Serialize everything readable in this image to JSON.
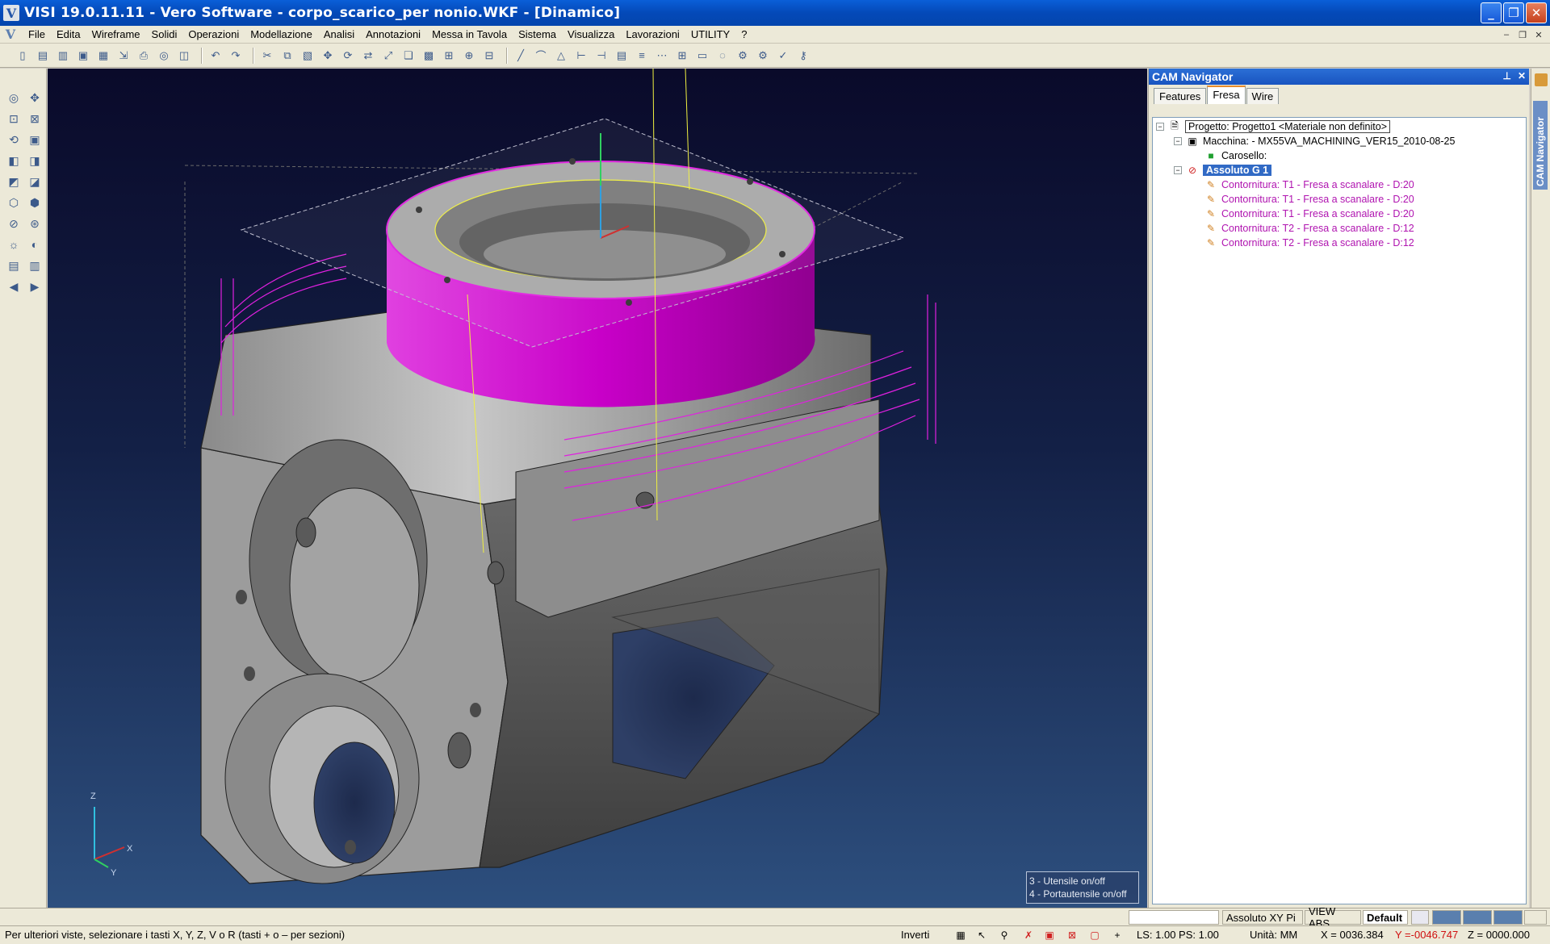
{
  "window": {
    "title": "VISI 19.0.11.11 - Vero Software - corpo_scarico_per nonio.WKF - [Dinamico]",
    "minimize": "_",
    "maximize": "❐",
    "close": "✕"
  },
  "menu": {
    "items": [
      "File",
      "Edita",
      "Wireframe",
      "Solidi",
      "Operazioni",
      "Modellazione",
      "Analisi",
      "Annotazioni",
      "Messa in Tavola",
      "Sistema",
      "Visualizza",
      "Lavorazioni",
      "UTILITY",
      "?"
    ]
  },
  "viewport": {
    "hint_lines": [
      "3 - Utensile on/off",
      "4 - Portautensile on/off"
    ],
    "triad_labels": {
      "x": "X",
      "y": "Y",
      "z": "Z"
    }
  },
  "cam_navigator": {
    "title": "CAM Navigator",
    "side_label": "CAM Navigator",
    "tabs": [
      {
        "label": "Features",
        "active": false
      },
      {
        "label": "Fresa",
        "active": true
      },
      {
        "label": "Wire",
        "active": false
      }
    ],
    "tree": {
      "project": "Progetto: Progetto1 <Materiale non definito>",
      "machine": "Macchina: - MX55VA_MACHINING_VER15_2010-08-25",
      "carousel": "Carosello:",
      "group": "Assoluto G 1",
      "operations": [
        "Contornitura: T1 - Fresa a scanalare - D:20",
        "Contornitura: T1 - Fresa a scanalare - D:20",
        "Contornitura: T1 - Fresa a scanalare - D:20",
        "Contornitura: T2 - Fresa a scanalare - D:12",
        "Contornitura: T2 - Fresa a scanalare - D:12"
      ]
    }
  },
  "status": {
    "search_placeholder": "",
    "plane": "Assoluto XY Pi",
    "view": "VIEW ABS",
    "layer": "Default",
    "message": "Per ulteriori viste, selezionare i tasti X, Y, Z, V o R (tasti  + o – per sezioni)",
    "invert": "Inverti",
    "ls_ps": "LS: 1.00 PS: 1.00",
    "units": "Unità: MM",
    "x": "X = 0036.384",
    "y": "Y =-0046.747",
    "z": "Z = 0000.000"
  },
  "colors": {
    "accent": "#316ac5",
    "toolpath": "#d000d0",
    "coord_y": "#d01010"
  }
}
